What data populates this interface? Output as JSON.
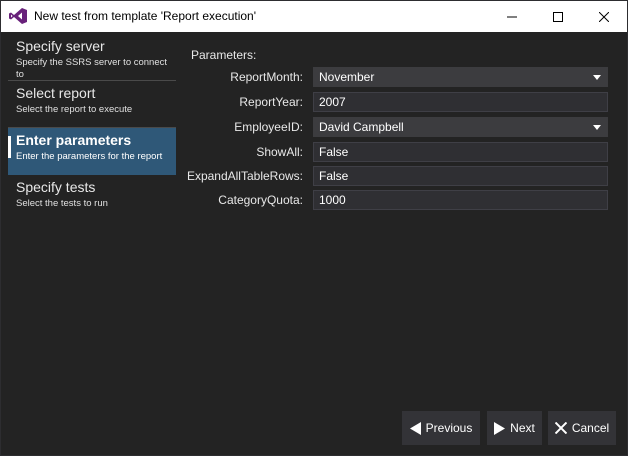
{
  "window": {
    "title": "New test from template 'Report execution'"
  },
  "sidebar": {
    "steps": [
      {
        "title": "Specify server",
        "description": "Specify the SSRS server to connect to",
        "active": false
      },
      {
        "title": "Select report",
        "description": "Select the report to execute",
        "active": false
      },
      {
        "title": "Enter parameters",
        "description": "Enter the parameters for the report",
        "active": true
      },
      {
        "title": "Specify tests",
        "description": "Select the tests to run",
        "active": false
      }
    ]
  },
  "parameters": {
    "heading": "Parameters:",
    "rows": [
      {
        "label": "ReportMonth:",
        "value": "November",
        "type": "select"
      },
      {
        "label": "ReportYear:",
        "value": "2007",
        "type": "text"
      },
      {
        "label": "EmployeeID:",
        "value": "David Campbell",
        "type": "select"
      },
      {
        "label": "ShowAll:",
        "value": "False",
        "type": "text"
      },
      {
        "label": "ExpandAllTableRows:",
        "value": "False",
        "type": "text"
      },
      {
        "label": "CategoryQuota:",
        "value": "1000",
        "type": "text"
      }
    ]
  },
  "buttons": {
    "previous": "Previous",
    "next": "Next",
    "cancel": "Cancel"
  },
  "colors": {
    "background": "#232323",
    "active_step": "#2f5878",
    "field": "#2f2f33",
    "button": "#333337",
    "accent_icon": "#68217a"
  }
}
